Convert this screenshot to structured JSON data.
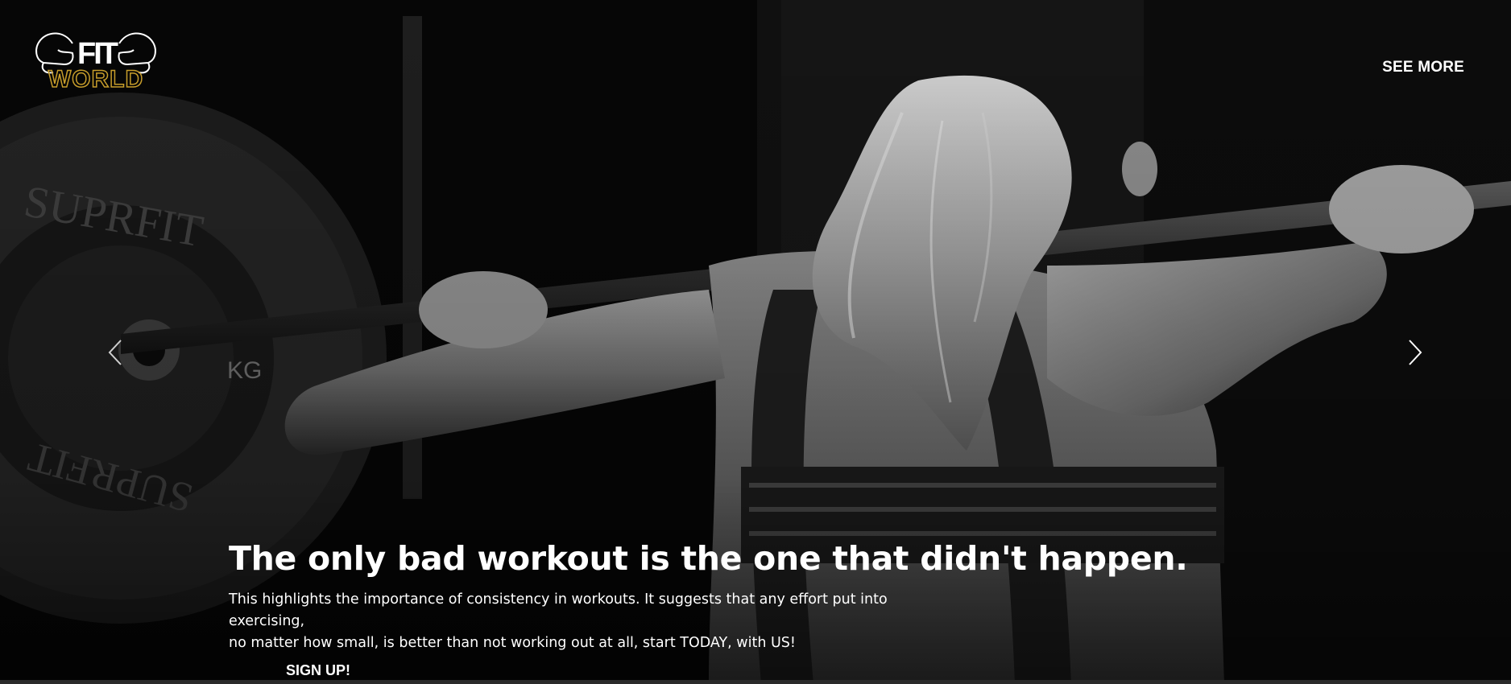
{
  "brand": {
    "logo_top": "FIT",
    "logo_bottom": "WORLD"
  },
  "nav": {
    "see_more_label": "SEE MORE"
  },
  "carousel": {
    "prev_icon": "chevron-left-icon",
    "next_icon": "chevron-right-icon"
  },
  "hero": {
    "headline": "The only bad workout is the one that didn't happen.",
    "description_line1": "This highlights the importance of consistency in workouts. It suggests that any effort put into exercising,",
    "description_line2": "no matter how small, is better than not working out at all, start TODAY, with US!",
    "cta_label": "SIGN UP!"
  },
  "colors": {
    "accent": "#c79d2b",
    "text": "#ffffff",
    "background": "#000000"
  }
}
